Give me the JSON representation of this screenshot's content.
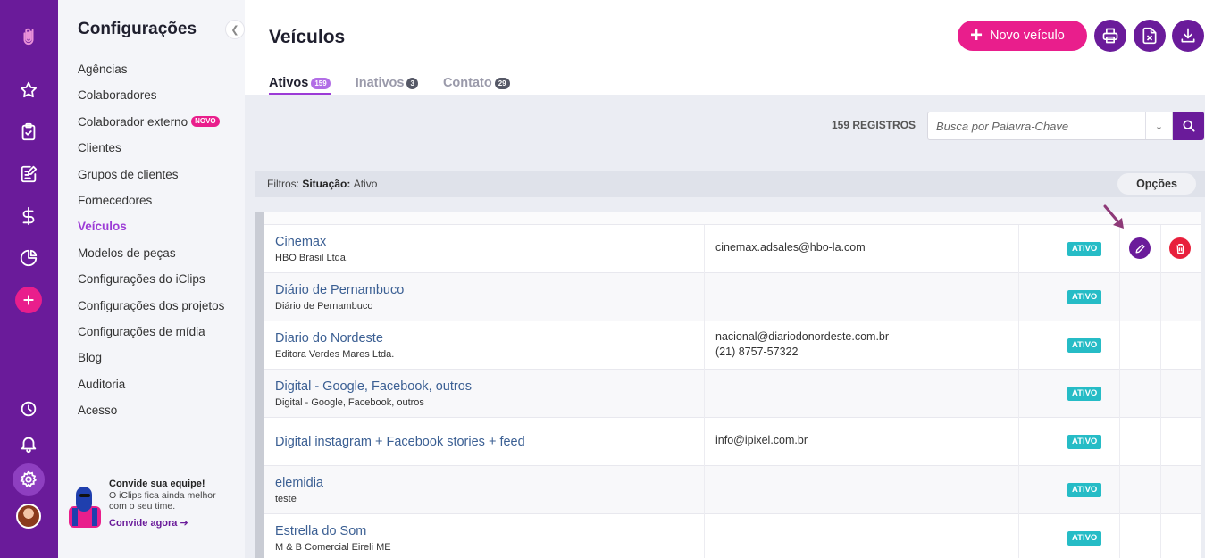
{
  "sidebar": {
    "title": "Configurações",
    "items": [
      {
        "label": "Agências"
      },
      {
        "label": "Colaboradores"
      },
      {
        "label": "Colaborador externo",
        "badge": "NOVO"
      },
      {
        "label": "Clientes"
      },
      {
        "label": "Grupos de clientes"
      },
      {
        "label": "Fornecedores"
      },
      {
        "label": "Veículos",
        "active": true
      },
      {
        "label": "Modelos de peças"
      },
      {
        "label": "Configurações do iClips"
      },
      {
        "label": "Configurações dos projetos"
      },
      {
        "label": "Configurações de mídia"
      },
      {
        "label": "Blog"
      },
      {
        "label": "Auditoria"
      },
      {
        "label": "Acesso"
      }
    ],
    "invite": {
      "title": "Convide sua equipe!",
      "subtitle": "O iClips fica ainda melhor com o seu time.",
      "link": "Convide agora"
    }
  },
  "rail_icons": [
    "paperclip-logo-icon",
    "star-icon",
    "clipboard-check-icon",
    "edit-document-icon",
    "dollar-icon",
    "pie-chart-icon",
    "plus-icon",
    "clock-icon",
    "bell-icon",
    "gear-icon",
    "avatar"
  ],
  "header": {
    "title": "Veículos",
    "new_button": "Novo veículo"
  },
  "tabs": [
    {
      "label": "Ativos",
      "count": "159",
      "active": true
    },
    {
      "label": "Inativos",
      "count": "3"
    },
    {
      "label": "Contato",
      "count": "29"
    }
  ],
  "toolbar": {
    "records": "159 REGISTROS",
    "search_placeholder": "Busca por Palavra-Chave"
  },
  "filters": {
    "prefix": "Filtros:",
    "key": "Situação",
    "value": "Ativo",
    "options_label": "Opções"
  },
  "rows": [
    {
      "name": "Cinemax",
      "sub": "HBO Brasil Ltda.",
      "contact": [
        "cinemax.adsales@hbo-la.com"
      ],
      "status": "ATIVO"
    },
    {
      "name": "Diário de Pernambuco",
      "sub": "Diário de Pernambuco",
      "contact": [],
      "status": "ATIVO"
    },
    {
      "name": "Diario do Nordeste",
      "sub": "Editora Verdes Mares Ltda.",
      "contact": [
        "nacional@diariodonordeste.com.br",
        "(21) 8757-57322"
      ],
      "status": "ATIVO"
    },
    {
      "name": "Digital - Google, Facebook, outros",
      "sub": "Digital - Google, Facebook, outros",
      "contact": [],
      "status": "ATIVO"
    },
    {
      "name": "Digital instagram + Facebook stories + feed",
      "sub": "",
      "contact": [
        "info@ipixel.com.br"
      ],
      "status": "ATIVO"
    },
    {
      "name": "elemidia",
      "sub": "teste",
      "contact": [],
      "status": "ATIVO"
    },
    {
      "name": "Estrella do Som",
      "sub": "M & B Comercial Eireli ME",
      "contact": [],
      "status": "ATIVO"
    }
  ],
  "colors": {
    "rail": "#6a1b9a",
    "accent_pink": "#e91e8c",
    "active_purple": "#9c3bd6",
    "status_teal": "#26bcc6",
    "delete_red": "#e8203c"
  }
}
